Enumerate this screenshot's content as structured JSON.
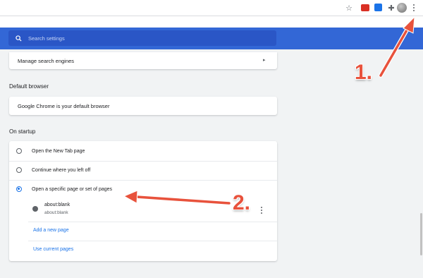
{
  "toolbar": {
    "icons": [
      "star-icon",
      "extension-icon",
      "extension-icon",
      "puzzle-icon",
      "avatar",
      "kebab-menu-icon"
    ],
    "star_glyph": "☆",
    "puzzle_glyph": "✚"
  },
  "search": {
    "placeholder": "Search settings"
  },
  "search_engine": {
    "manage_label": "Manage search engines",
    "chevron": "▸"
  },
  "default_browser": {
    "title": "Default browser",
    "status": "Google Chrome is your default browser"
  },
  "on_startup": {
    "title": "On startup",
    "options": [
      {
        "label": "Open the New Tab page",
        "selected": false
      },
      {
        "label": "Continue where you left off",
        "selected": false
      },
      {
        "label": "Open a specific page or set of pages",
        "selected": true
      }
    ],
    "pages": [
      {
        "title": "about:blank",
        "url": "about:blank"
      }
    ],
    "add_page_label": "Add a new page",
    "use_current_label": "Use current pages"
  },
  "annotations": {
    "step1": "1.",
    "step2": "2."
  },
  "colors": {
    "header": "#3367d6",
    "accent": "#1a73e8",
    "annotation": "#e8523c"
  }
}
